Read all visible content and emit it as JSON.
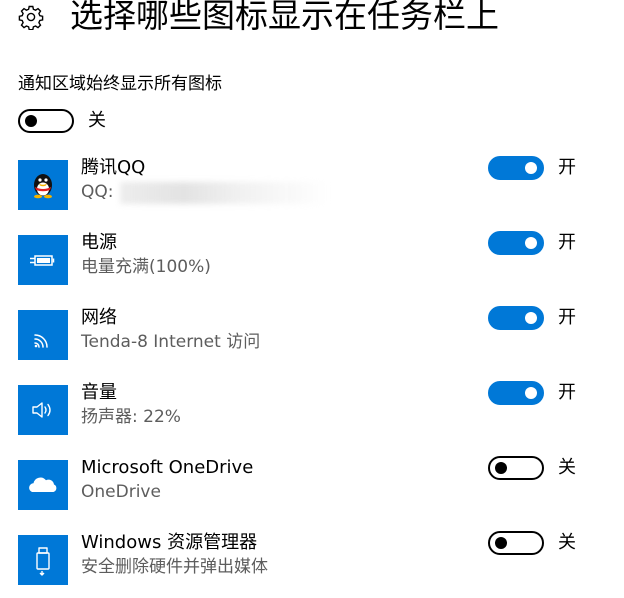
{
  "header": {
    "title": "选择哪些图标显示在任务栏上",
    "icon": "gear-icon"
  },
  "master": {
    "label": "通知区域始终显示所有图标",
    "state": "off",
    "state_label": "关"
  },
  "items": [
    {
      "name": "腾讯QQ",
      "sub": "QQ:",
      "icon": "qq-penguin-icon",
      "state": "on",
      "state_label": "开"
    },
    {
      "name": "电源",
      "sub": "电量充满(100%)",
      "icon": "battery-icon",
      "state": "on",
      "state_label": "开"
    },
    {
      "name": "网络",
      "sub": "Tenda-8 Internet 访问",
      "icon": "wifi-icon",
      "state": "on",
      "state_label": "开"
    },
    {
      "name": "音量",
      "sub": "扬声器: 22%",
      "icon": "speaker-icon",
      "state": "on",
      "state_label": "开"
    },
    {
      "name": "Microsoft OneDrive",
      "sub": "OneDrive",
      "icon": "onedrive-cloud-icon",
      "state": "off",
      "state_label": "关"
    },
    {
      "name": "Windows 资源管理器",
      "sub": "安全删除硬件并弹出媒体",
      "icon": "usb-drive-icon",
      "state": "off",
      "state_label": "关"
    }
  ],
  "colors": {
    "accent": "#0078d7",
    "secondary_text": "#5d5d5d"
  }
}
